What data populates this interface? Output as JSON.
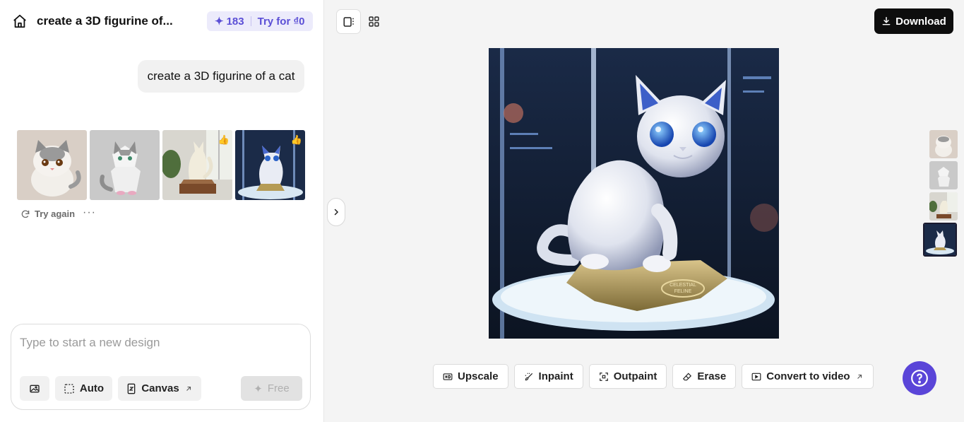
{
  "header": {
    "title": "create a 3D figurine of...",
    "credits_count": "183",
    "try_label": "Try for ₫0",
    "home_icon": "home-icon"
  },
  "chat": {
    "prompt": "create a 3D figurine of a cat",
    "thumbnails": [
      {
        "style": "chibi-cat",
        "badge": ""
      },
      {
        "style": "lowpoly-cat",
        "badge": ""
      },
      {
        "style": "wooden-room-cat",
        "badge": "👍"
      },
      {
        "style": "space-cat",
        "badge": "👍"
      }
    ],
    "try_again_label": "Try again",
    "more_label": "···"
  },
  "composer": {
    "placeholder": "Type to start a new design",
    "auto_label": "Auto",
    "canvas_label": "Canvas",
    "free_label": "Free"
  },
  "toolbar": {
    "download_label": "Download"
  },
  "main_image": {
    "plate_text_1": "CELESTIAL",
    "plate_text_2": "FELINE"
  },
  "tools": {
    "upscale": "Upscale",
    "inpaint": "Inpaint",
    "outpaint": "Outpaint",
    "erase": "Erase",
    "convert": "Convert to video"
  },
  "colors": {
    "accent": "#5a45d8",
    "credits_bg": "#ecebfb",
    "download_bg": "#0d0d0d"
  }
}
